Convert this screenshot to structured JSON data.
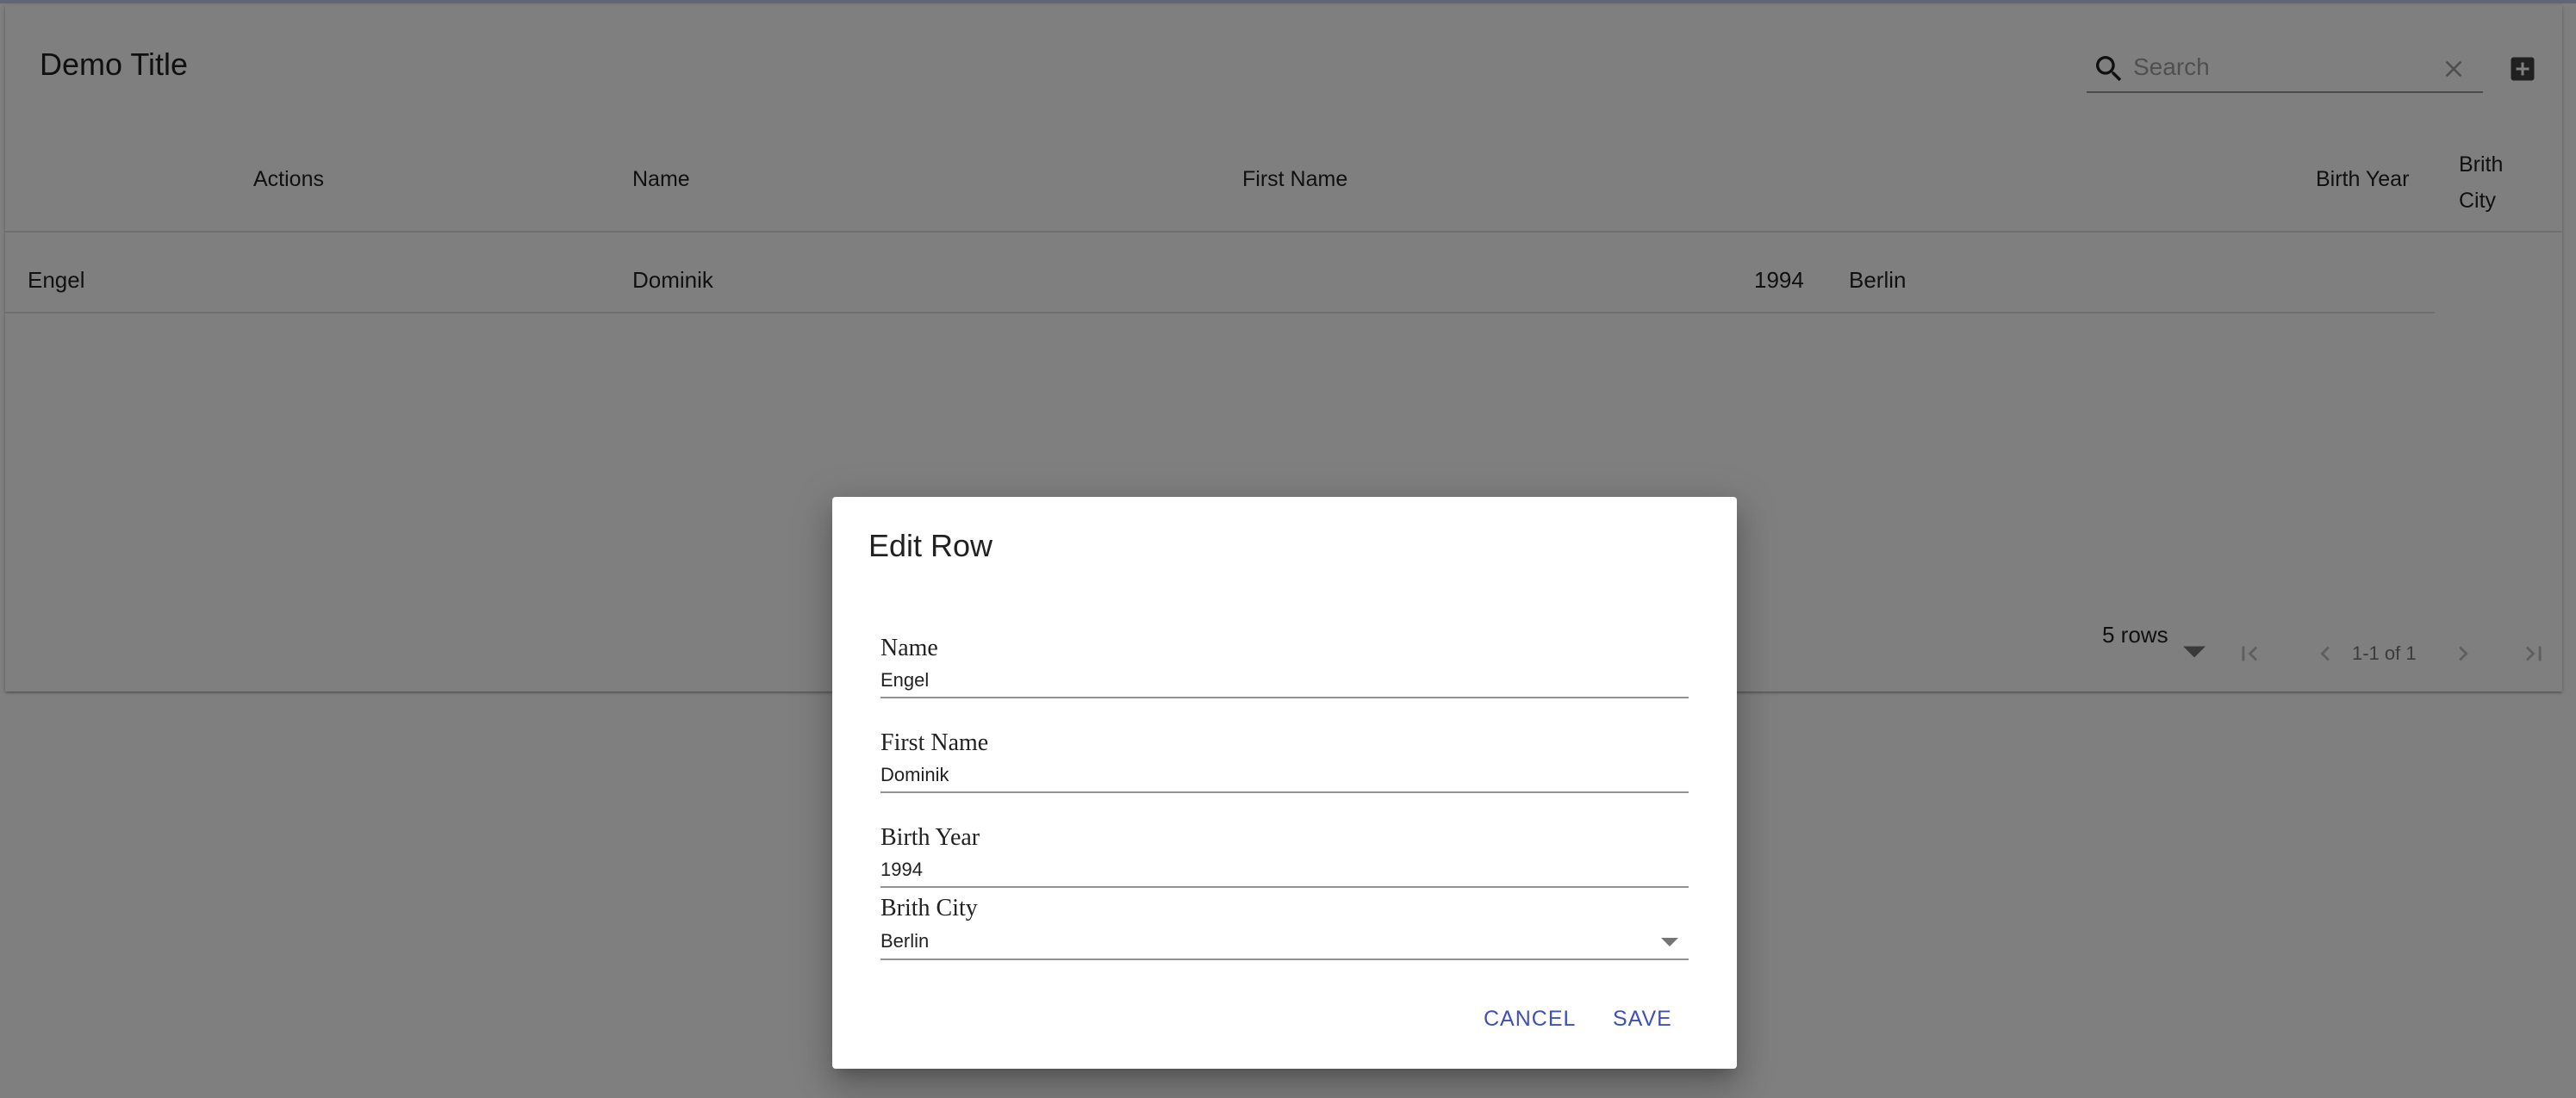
{
  "table": {
    "title": "Demo Title",
    "search": {
      "placeholder": "Search",
      "value": ""
    },
    "columns": [
      "Actions",
      "Name",
      "First Name",
      "Birth Year",
      "Brith City"
    ],
    "rows": [
      {
        "name": "Engel",
        "first_name": "Dominik",
        "birth_year": "1994",
        "birth_city": "Berlin"
      }
    ],
    "pagination": {
      "rows_per_page": "5 rows",
      "range_label": "1-1 of 1"
    }
  },
  "dialog": {
    "title": "Edit Row",
    "fields": {
      "name": {
        "label": "Name",
        "value": "Engel"
      },
      "first_name": {
        "label": "First Name",
        "value": "Dominik"
      },
      "birth_year": {
        "label": "Birth Year",
        "value": "1994"
      },
      "birth_city": {
        "label": "Brith City",
        "value": "Berlin"
      }
    },
    "buttons": {
      "cancel": "CANCEL",
      "save": "SAVE"
    }
  },
  "icons": {
    "search": "search-icon",
    "clear": "close-icon",
    "add": "add-box-icon",
    "first_page": "first-page-icon",
    "prev_page": "chevron-left-icon",
    "next_page": "chevron-right-icon",
    "last_page": "last-page-icon",
    "dropdown": "arrow-drop-down-icon"
  },
  "colors": {
    "primary": "#3f51b5",
    "backdrop": "rgba(0,0,0,0.5)"
  }
}
